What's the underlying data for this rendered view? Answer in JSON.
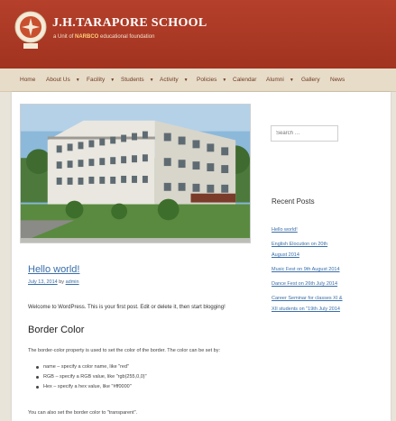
{
  "header": {
    "school_name": "J.H.TARAPORE SCHOOL",
    "tagline_prefix": "a Unit of ",
    "tagline_brand": "NARBCO",
    "tagline_suffix": " educational foundation",
    "brand_color": "#a8371f"
  },
  "nav": {
    "items": [
      {
        "label": "Home",
        "has_dropdown": false
      },
      {
        "label": "About Us",
        "has_dropdown": true
      },
      {
        "label": "Facility",
        "has_dropdown": true
      },
      {
        "label": "Students",
        "has_dropdown": true
      },
      {
        "label": "Activity",
        "has_dropdown": true
      },
      {
        "label": "Policies",
        "has_dropdown": true
      },
      {
        "label": "Calendar",
        "has_dropdown": false
      },
      {
        "label": "Alumni",
        "has_dropdown": true
      },
      {
        "label": "Gallery",
        "has_dropdown": false
      },
      {
        "label": "News",
        "has_dropdown": false
      }
    ],
    "dropdown_glyph": "▼"
  },
  "post": {
    "title": "Hello world!",
    "date": "July 13, 2014",
    "by": " by ",
    "author": "admin",
    "welcome": "Welcome to WordPress. This is your first post. Edit or delete it, then start blogging!",
    "section_title": "Border Color",
    "description": "The border-color property is used to set the color of the border. The color can be set by:",
    "bullets": [
      "name – specify a color name, like \"red\"",
      "RGB – specify a RGB value, like \"rgb(255,0,0)\"",
      "Hex – specify a hex value, like \"#ff0000\""
    ],
    "tail": "You can also set the border color to \"transparent\"."
  },
  "sidebar": {
    "search_placeholder": "Search …",
    "recent_title": "Recent Posts",
    "recent_posts": [
      "Hello world!",
      "English Elocution on 20th August 2014",
      "Music Fest on 9th August 2014",
      "Dance Fest on 26th July 2014",
      "Career Seminar for classes XI & XII students on \"19th July 2014"
    ]
  }
}
